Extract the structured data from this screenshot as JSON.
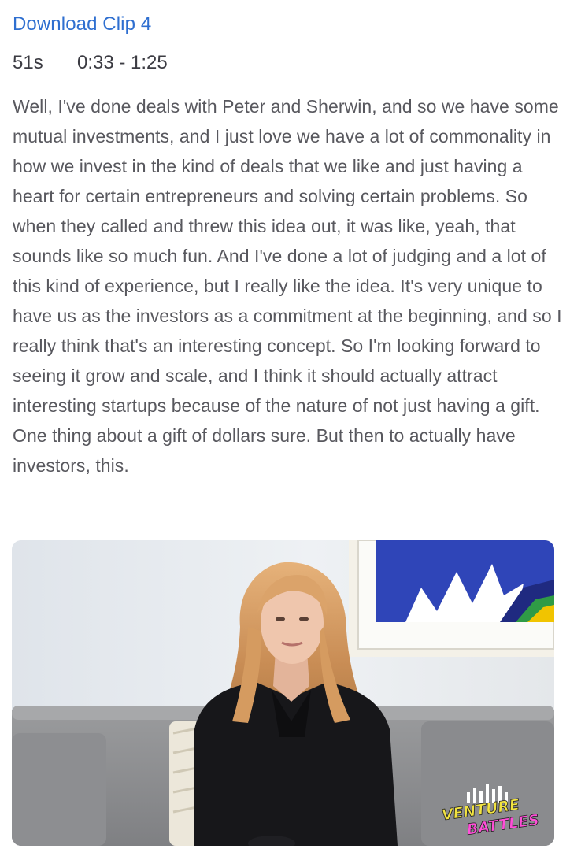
{
  "clip": {
    "download_label": "Download Clip 4",
    "duration": "51s",
    "time_range": "0:33 - 1:25",
    "transcript": "Well, I've done deals with Peter and Sherwin, and so we have some mutual investments, and I just love we have a lot of commonality in how we invest in the kind of deals that we like and just having a heart for certain entrepreneurs and solving certain problems. So when they called and threw this idea out, it was like, yeah, that sounds like so much fun. And I've done a lot of judging and a lot of this kind of experience, but I really like the idea. It's very unique to have us as the investors as a commitment at the beginning, and so I really think that's an interesting concept. So I'm looking forward to seeing it grow and scale, and I think it should actually attract interesting startups because of the nature of not just having a gift. One thing about a gift of dollars sure. But then to actually have investors, this."
  },
  "thumbnail": {
    "watermark_line1": "VENTURE",
    "watermark_line2": "BATTLES",
    "colors": {
      "link": "#2f6fd0",
      "text": "#58585e",
      "watermark_pink": "#ff4fd8",
      "watermark_yellow": "#f2e341"
    }
  }
}
